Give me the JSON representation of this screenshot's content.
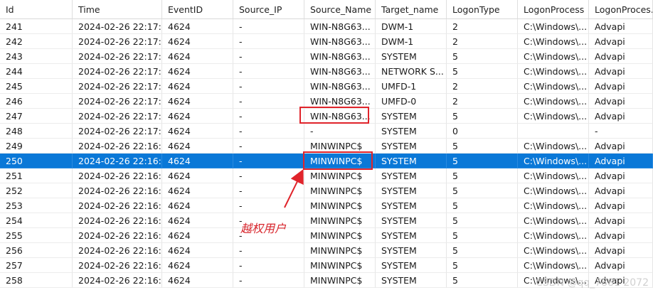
{
  "columns": [
    "Id",
    "Time",
    "EventID",
    "Source_IP",
    "Source_Name",
    "Target_name",
    "LogonType",
    "LogonProcess",
    "LogonProces..."
  ],
  "rows": [
    [
      "241",
      "2024-02-26 22:17:...",
      "4624",
      "-",
      "WIN-N8G63...",
      "DWM-1",
      "2",
      "C:\\Windows\\...",
      "Advapi"
    ],
    [
      "242",
      "2024-02-26 22:17:...",
      "4624",
      "-",
      "WIN-N8G63...",
      "DWM-1",
      "2",
      "C:\\Windows\\...",
      "Advapi"
    ],
    [
      "243",
      "2024-02-26 22:17:...",
      "4624",
      "-",
      "WIN-N8G63...",
      "SYSTEM",
      "5",
      "C:\\Windows\\...",
      "Advapi"
    ],
    [
      "244",
      "2024-02-26 22:17:...",
      "4624",
      "-",
      "WIN-N8G63...",
      "NETWORK S...",
      "5",
      "C:\\Windows\\...",
      "Advapi"
    ],
    [
      "245",
      "2024-02-26 22:17:...",
      "4624",
      "-",
      "WIN-N8G63...",
      "UMFD-1",
      "2",
      "C:\\Windows\\...",
      "Advapi"
    ],
    [
      "246",
      "2024-02-26 22:17:...",
      "4624",
      "-",
      "WIN-N8G63...",
      "UMFD-0",
      "2",
      "C:\\Windows\\...",
      "Advapi"
    ],
    [
      "247",
      "2024-02-26 22:17:...",
      "4624",
      "-",
      "WIN-N8G63...",
      "SYSTEM",
      "5",
      "C:\\Windows\\...",
      "Advapi"
    ],
    [
      "248",
      "2024-02-26 22:17:...",
      "4624",
      "-",
      "-",
      "SYSTEM",
      "0",
      "",
      "-"
    ],
    [
      "249",
      "2024-02-26 22:16:...",
      "4624",
      "-",
      "MINWINPC$",
      "SYSTEM",
      "5",
      "C:\\Windows\\...",
      "Advapi"
    ],
    [
      "250",
      "2024-02-26 22:16:...",
      "4624",
      "-",
      "MINWINPC$",
      "SYSTEM",
      "5",
      "C:\\Windows\\...",
      "Advapi"
    ],
    [
      "251",
      "2024-02-26 22:16:...",
      "4624",
      "-",
      "MINWINPC$",
      "SYSTEM",
      "5",
      "C:\\Windows\\...",
      "Advapi"
    ],
    [
      "252",
      "2024-02-26 22:16:...",
      "4624",
      "-",
      "MINWINPC$",
      "SYSTEM",
      "5",
      "C:\\Windows\\...",
      "Advapi"
    ],
    [
      "253",
      "2024-02-26 22:16:...",
      "4624",
      "-",
      "MINWINPC$",
      "SYSTEM",
      "5",
      "C:\\Windows\\...",
      "Advapi"
    ],
    [
      "254",
      "2024-02-26 22:16:...",
      "4624",
      "-",
      "MINWINPC$",
      "SYSTEM",
      "5",
      "C:\\Windows\\...",
      "Advapi"
    ],
    [
      "255",
      "2024-02-26 22:16:...",
      "4624",
      "-",
      "MINWINPC$",
      "SYSTEM",
      "5",
      "C:\\Windows\\...",
      "Advapi"
    ],
    [
      "256",
      "2024-02-26 22:16:...",
      "4624",
      "-",
      "MINWINPC$",
      "SYSTEM",
      "5",
      "C:\\Windows\\...",
      "Advapi"
    ],
    [
      "257",
      "2024-02-26 22:16:...",
      "4624",
      "-",
      "MINWINPC$",
      "SYSTEM",
      "5",
      "C:\\Windows\\...",
      "Advapi"
    ],
    [
      "258",
      "2024-02-26 22:16:...",
      "4624",
      "-",
      "MINWINPC$",
      "SYSTEM",
      "5",
      "C:\\Windows\\...",
      "Advapi"
    ]
  ],
  "selected_row_id": "250",
  "annotation": {
    "text": "越权用户",
    "color": "#e0242b"
  },
  "watermark": "CSDN @qq_7881 2072",
  "colors": {
    "selection": "#0a78d7",
    "highlight": "#e0242b"
  }
}
